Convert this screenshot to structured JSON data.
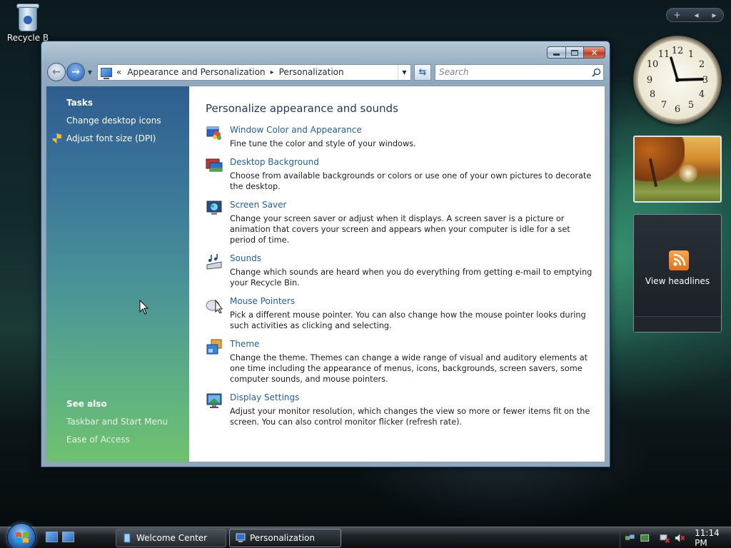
{
  "desktop": {
    "recycle_bin_label": "Recycle B"
  },
  "window": {
    "address": {
      "breadcrumb_prefix": "«",
      "crumbs": [
        "Appearance and Personalization",
        "Personalization"
      ],
      "separator": "▸"
    },
    "search_placeholder": "Search",
    "sidebar": {
      "tasks_title": "Tasks",
      "tasks": [
        "Change desktop icons",
        "Adjust font size (DPI)"
      ],
      "see_also_title": "See also",
      "see_also": [
        "Taskbar and Start Menu",
        "Ease of Access"
      ]
    },
    "main": {
      "title": "Personalize appearance and sounds",
      "items": [
        {
          "link": "Window Color and Appearance",
          "desc": "Fine tune the color and style of your windows.",
          "icon": "window-color-icon"
        },
        {
          "link": "Desktop Background",
          "desc": "Choose from available backgrounds or colors or use one of your own pictures to decorate the desktop.",
          "icon": "desktop-background-icon"
        },
        {
          "link": "Screen Saver",
          "desc": "Change your screen saver or adjust when it displays. A screen saver is a picture or animation that covers your screen and appears when your computer is idle for a set period of time.",
          "icon": "screen-saver-icon"
        },
        {
          "link": "Sounds",
          "desc": "Change which sounds are heard when you do everything from getting e-mail to emptying your Recycle Bin.",
          "icon": "sounds-icon"
        },
        {
          "link": "Mouse Pointers",
          "desc": "Pick a different mouse pointer. You can also change how the mouse pointer looks during such activities as clicking and selecting.",
          "icon": "mouse-pointers-icon"
        },
        {
          "link": "Theme",
          "desc": "Change the theme. Themes can change a wide range of visual and auditory elements at one time including the appearance of menus, icons, backgrounds, screen savers, some computer sounds, and mouse pointers.",
          "icon": "theme-icon"
        },
        {
          "link": "Display Settings",
          "desc": "Adjust your monitor resolution, which changes the view so more or fewer items fit on the screen. You can also control monitor flicker (refresh rate).",
          "icon": "display-settings-icon"
        }
      ]
    }
  },
  "gadgets": {
    "control_add": "+",
    "clock_numbers": [
      "12",
      "1",
      "2",
      "3",
      "4",
      "5",
      "6",
      "7",
      "8",
      "9",
      "10",
      "11"
    ],
    "feed_label": "View headlines"
  },
  "taskbar": {
    "buttons": [
      "Welcome Center",
      "Personalization"
    ],
    "clock": "11:14 PM"
  },
  "colors": {
    "link": "#1f5fa8",
    "title": "#1e3a6a",
    "sidebar_top": "#2f5e8f",
    "sidebar_bottom": "#6fc26f"
  }
}
